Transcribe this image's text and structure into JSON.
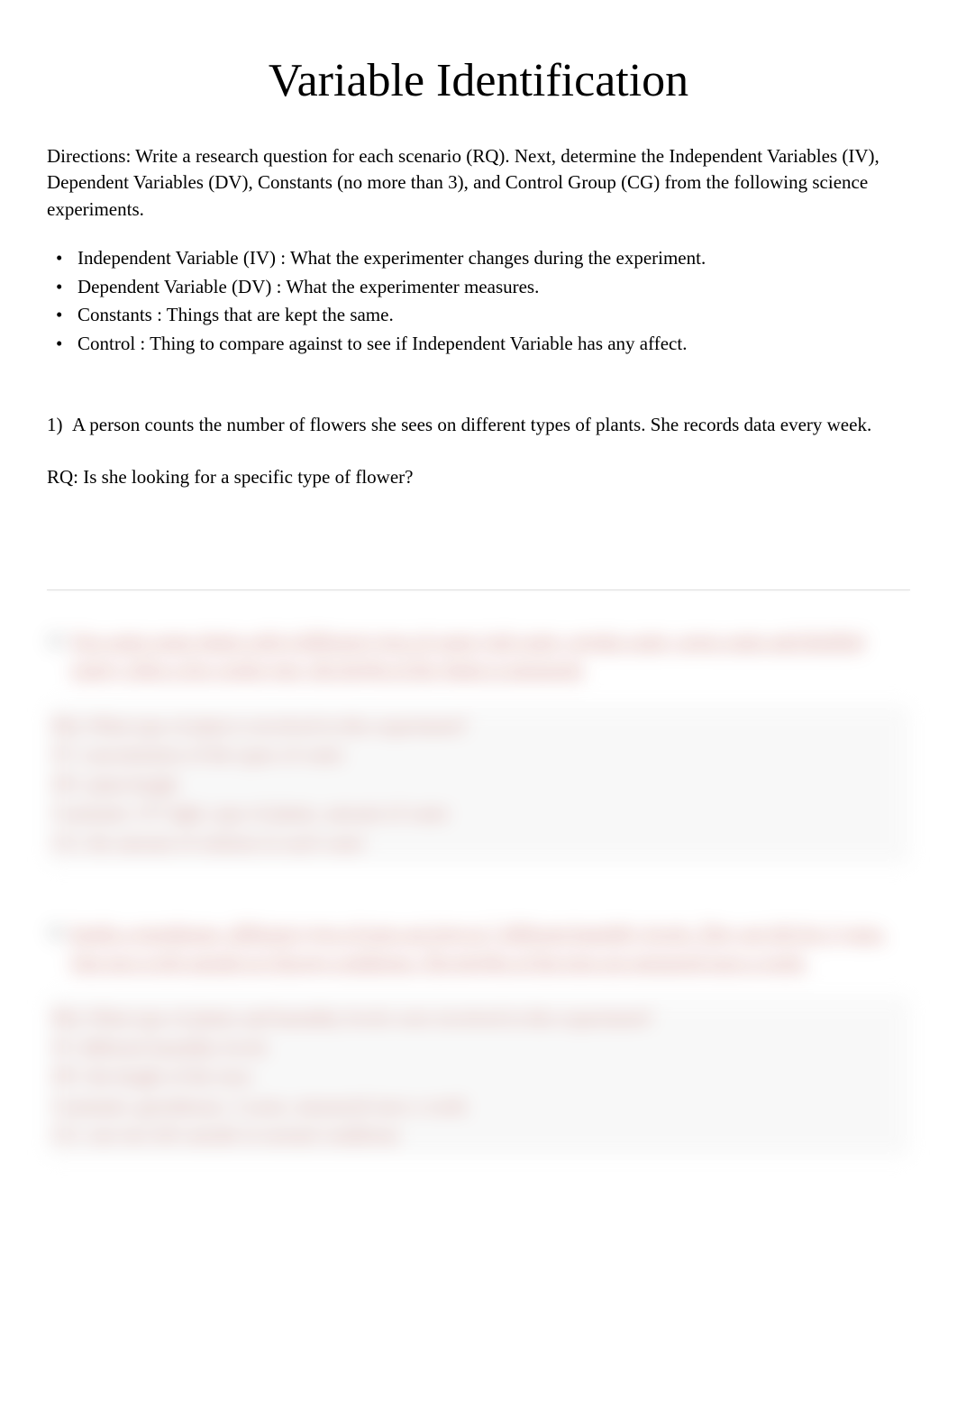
{
  "title": "Variable Identification",
  "directions": "Directions: Write a research question for each scenario (RQ).   Next, determine the Independent Variables (IV), Dependent Variables (DV), Constants (no more than 3), and Control Group (CG) from the following science experiments.",
  "definitions": [
    "Independent Variable (IV)    : What the experimenter changes during the experiment.",
    "Dependent Variable (DV)   :  What the experimenter measures.",
    "Constants :   Things that are kept the same.",
    "Control :   Thing to compare against to see if Independent Variable has any affect."
  ],
  "question1": {
    "number": "1)",
    "text": "A person counts the number of flowers she sees on different types of plants.   She records data every week.",
    "rq": "RQ: Is she looking for a specific type of flower?"
  },
  "blurred": {
    "q2": {
      "number": "2)",
      "text": "You water some plants with 4 different types of water (salt water, regular water, sugar water and distilled water). After a few weeks pass, the height of the plants is measured.",
      "answers": [
        "RQ: What type of plant is involved in this experiment?",
        "IV: concentration of the types of water",
        "DV: plant height",
        "Constants:  UV light,  type of plants,  amount of water",
        "CG: the amount of solution in each water"
      ]
    },
    "q3": {
      "number": "3)",
      "text": "Inside a greenhouse, different types of trees are kept at 7 different humidity levels.  They are left for 3 years. One tree is left outside in Chicago conditions.   The heights of the trees are measured once a week.",
      "answers": [
        "RQ: What type of plants and humidity levels were involved in this experiment?",
        "IV: different humidity levels",
        "DV: the height of the trees",
        "Constants: greenhouse,  3 years,  measured once a week",
        "CG: one tree left outside in normal conditions"
      ]
    }
  }
}
